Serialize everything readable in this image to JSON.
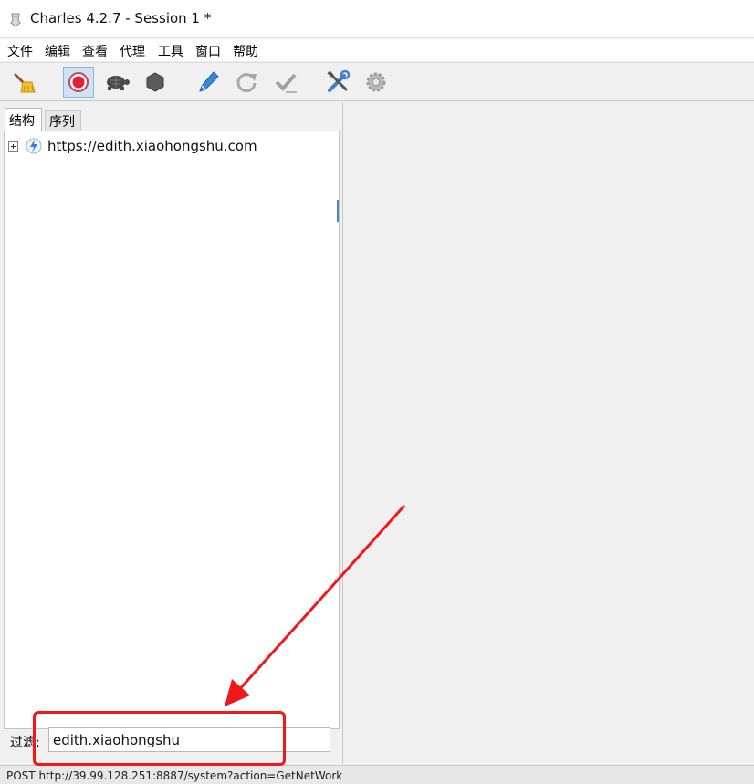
{
  "window": {
    "title": "Charles 4.2.7 - Session 1 *"
  },
  "menubar": {
    "items": [
      {
        "label": "文件"
      },
      {
        "label": "编辑"
      },
      {
        "label": "查看"
      },
      {
        "label": "代理"
      },
      {
        "label": "工具"
      },
      {
        "label": "窗口"
      },
      {
        "label": "帮助"
      }
    ]
  },
  "toolbar": {
    "buttons": [
      {
        "icon": "broom-icon",
        "state": "normal"
      },
      {
        "icon": "record-icon",
        "state": "active"
      },
      {
        "icon": "turtle-icon",
        "state": "normal"
      },
      {
        "icon": "stop-hexagon-icon",
        "state": "normal"
      },
      {
        "icon": "pen-icon",
        "state": "normal"
      },
      {
        "icon": "refresh-icon",
        "state": "disabled"
      },
      {
        "icon": "checkmark-icon",
        "state": "disabled"
      },
      {
        "icon": "tools-icon",
        "state": "normal"
      },
      {
        "icon": "gear-icon",
        "state": "disabled"
      }
    ]
  },
  "left_pane": {
    "tabs": [
      {
        "label": "结构",
        "selected": true
      },
      {
        "label": "序列",
        "selected": false
      }
    ],
    "tree": [
      {
        "label": "https://edith.xiaohongshu.com",
        "icon": "lightning-icon",
        "expanded": false
      }
    ],
    "filter": {
      "label": "过滤:",
      "value": "edith.xiaohongshu"
    }
  },
  "statusbar": {
    "text": "POST http://39.99.128.251:8887/system?action=GetNetWork"
  },
  "colors": {
    "annotation": "#f01818",
    "active_button": "#cfe3f7",
    "record_red": "#e0203a"
  }
}
